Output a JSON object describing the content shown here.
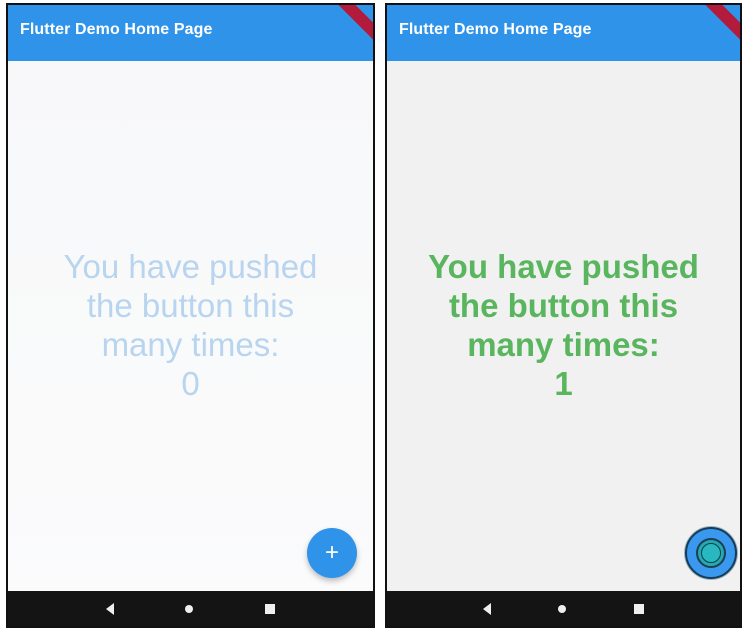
{
  "left_screen": {
    "app_bar_title": "Flutter Demo Home Page",
    "message_lines": [
      "You have pushed",
      "the button this",
      "many times:"
    ],
    "counter": "0",
    "fab_icon": "+"
  },
  "right_screen": {
    "app_bar_title": "Flutter Demo Home Page",
    "message_lines": [
      "You have pushed",
      "the button this",
      "many times:"
    ],
    "counter": "1",
    "fab_icon": "circle-ripple"
  },
  "nav": {
    "back_icon": "back-triangle-icon",
    "home_icon": "home-circle-icon",
    "recents_icon": "recents-square-icon"
  },
  "colors": {
    "app_bar": "#2f93e9",
    "left_message": "#b8d4ef",
    "right_message": "#5ab55f",
    "nav_bar": "#141414",
    "fab": "#2f93e9"
  }
}
